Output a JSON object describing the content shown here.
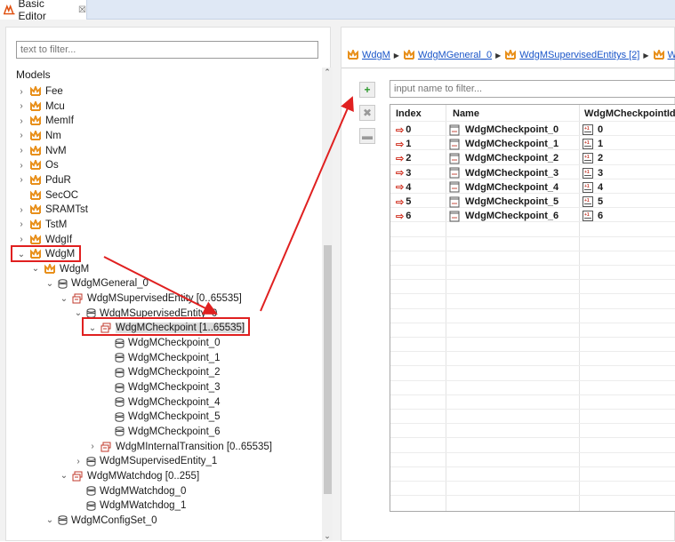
{
  "editor_tab": {
    "title": "Basic Editor",
    "close": "☒"
  },
  "left": {
    "filter_placeholder": "text to filter...",
    "models_label": "Models",
    "tree": [
      {
        "label": "Fee",
        "icon": "module-icon",
        "twisty": "›"
      },
      {
        "label": "Mcu",
        "icon": "module-icon",
        "twisty": "›"
      },
      {
        "label": "MemIf",
        "icon": "module-icon",
        "twisty": "›"
      },
      {
        "label": "Nm",
        "icon": "module-icon",
        "twisty": "›"
      },
      {
        "label": "NvM",
        "icon": "module-icon",
        "twisty": "›"
      },
      {
        "label": "Os",
        "icon": "module-icon",
        "twisty": "›"
      },
      {
        "label": "PduR",
        "icon": "module-icon",
        "twisty": "›"
      },
      {
        "label": "SecOC",
        "icon": "module-icon",
        "twisty": ""
      },
      {
        "label": "SRAMTst",
        "icon": "module-icon",
        "twisty": "›"
      },
      {
        "label": "TstM",
        "icon": "module-icon",
        "twisty": "›"
      },
      {
        "label": "WdgIf",
        "icon": "module-icon",
        "twisty": "›"
      },
      {
        "label": "WdgM",
        "icon": "module-icon",
        "twisty": "⌄"
      },
      {
        "label": "WdgM",
        "icon": "module-icon",
        "twisty": "⌄"
      },
      {
        "label": "WdgMGeneral_0",
        "icon": "container-icon",
        "twisty": "⌄"
      },
      {
        "label": "WdgMSupervisedEntity [0..65535]",
        "icon": "collection-icon",
        "twisty": "⌄"
      },
      {
        "label": "WdgMSupervisedEntity_0",
        "icon": "container-icon",
        "twisty": "⌄"
      },
      {
        "label": "WdgMCheckpoint [1..65535]",
        "icon": "collection-icon",
        "twisty": "⌄"
      },
      {
        "label": "WdgMCheckpoint_0",
        "icon": "container-icon",
        "twisty": ""
      },
      {
        "label": "WdgMCheckpoint_1",
        "icon": "container-icon",
        "twisty": ""
      },
      {
        "label": "WdgMCheckpoint_2",
        "icon": "container-icon",
        "twisty": ""
      },
      {
        "label": "WdgMCheckpoint_3",
        "icon": "container-icon",
        "twisty": ""
      },
      {
        "label": "WdgMCheckpoint_4",
        "icon": "container-icon",
        "twisty": ""
      },
      {
        "label": "WdgMCheckpoint_5",
        "icon": "container-icon",
        "twisty": ""
      },
      {
        "label": "WdgMCheckpoint_6",
        "icon": "container-icon",
        "twisty": ""
      },
      {
        "label": "WdgMInternalTransition [0..65535]",
        "icon": "collection-icon",
        "twisty": "›"
      },
      {
        "label": "WdgMSupervisedEntity_1",
        "icon": "container-icon",
        "twisty": "›"
      },
      {
        "label": "WdgMWatchdog [0..255]",
        "icon": "collection-icon",
        "twisty": "⌄"
      },
      {
        "label": "WdgMWatchdog_0",
        "icon": "container-icon",
        "twisty": ""
      },
      {
        "label": "WdgMWatchdog_1",
        "icon": "container-icon",
        "twisty": ""
      },
      {
        "label": "WdgMConfigSet_0",
        "icon": "container-icon",
        "twisty": "⌄"
      }
    ]
  },
  "right": {
    "breadcrumb": [
      "WdgM",
      "WdgMGeneral_0",
      "WdgMSupervisedEntitys [2]",
      "W"
    ],
    "filter_placeholder": "input name to filter...",
    "toolbar": {
      "add": "+",
      "remove": "✖",
      "other": "▬"
    },
    "table": {
      "headers": [
        "Index",
        "Name",
        "WdgMCheckpointId"
      ],
      "rows": [
        {
          "index": "0",
          "name": "WdgMCheckpoint_0",
          "id": "0"
        },
        {
          "index": "1",
          "name": "WdgMCheckpoint_1",
          "id": "1"
        },
        {
          "index": "2",
          "name": "WdgMCheckpoint_2",
          "id": "2"
        },
        {
          "index": "3",
          "name": "WdgMCheckpoint_3",
          "id": "3"
        },
        {
          "index": "4",
          "name": "WdgMCheckpoint_4",
          "id": "4"
        },
        {
          "index": "5",
          "name": "WdgMCheckpoint_5",
          "id": "5"
        },
        {
          "index": "6",
          "name": "WdgMCheckpoint_6",
          "id": "6"
        }
      ]
    }
  },
  "colors": {
    "highlight": "#e02020",
    "link": "#1a55c8",
    "module_icon": "#e8901c"
  }
}
